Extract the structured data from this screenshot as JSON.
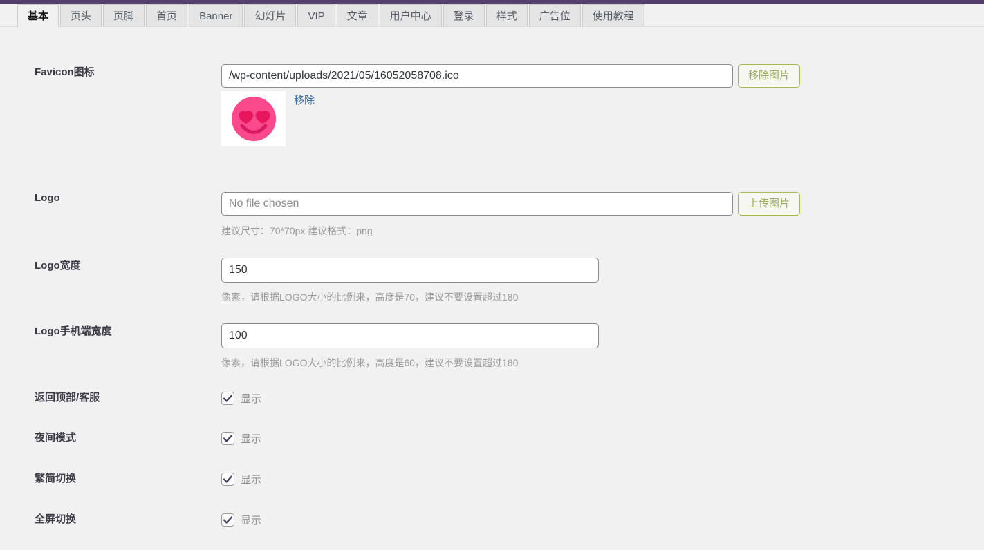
{
  "theme": {
    "adminbar_color": "#523f6d",
    "page_background": "#f1f1f1",
    "tab_inactive_background": "#e5e5e5",
    "button_border_color": "#a4bb47",
    "button_text_color": "#9aab5b",
    "link_color": "#3a6fb0",
    "checkmark_color": "#4b3f63",
    "favicon_face_color": "#fb4a8b",
    "favicon_feature_color": "#d81b60"
  },
  "tabs": [
    {
      "label": "基本",
      "active": true
    },
    {
      "label": "页头",
      "active": false
    },
    {
      "label": "页脚",
      "active": false
    },
    {
      "label": "首页",
      "active": false
    },
    {
      "label": "Banner",
      "active": false
    },
    {
      "label": "幻灯片",
      "active": false
    },
    {
      "label": "VIP",
      "active": false
    },
    {
      "label": "文章",
      "active": false
    },
    {
      "label": "用户中心",
      "active": false
    },
    {
      "label": "登录",
      "active": false
    },
    {
      "label": "样式",
      "active": false
    },
    {
      "label": "广告位",
      "active": false
    },
    {
      "label": "使用教程",
      "active": false
    }
  ],
  "rows": {
    "favicon": {
      "label": "Favicon图标",
      "input_value": "/wp-content/uploads/2021/05/16052058708.ico",
      "input_placeholder": "",
      "button_label": "移除图片",
      "remove_link_label": "移除",
      "preview_alt": "favicon-preview"
    },
    "logo": {
      "label": "Logo",
      "input_value": "",
      "input_placeholder": "No file chosen",
      "button_label": "上传图片",
      "help": "建议尺寸：70*70px 建议格式：png"
    },
    "logo_width": {
      "label": "Logo宽度",
      "input_value": "150",
      "input_placeholder": "",
      "help": "像素，请根据LOGO大小的比例来，高度是70，建议不要设置超过180"
    },
    "logo_mobile_width": {
      "label": "Logo手机端宽度",
      "input_value": "100",
      "input_placeholder": "",
      "help": "像素，请根据LOGO大小的比例来，高度是60，建议不要设置超过180"
    },
    "back_to_top": {
      "label": "返回顶部/客服",
      "checkbox_label": "显示",
      "checked": true
    },
    "night_mode": {
      "label": "夜间模式",
      "checkbox_label": "显示",
      "checked": true
    },
    "traditional_simplified": {
      "label": "繁简切换",
      "checkbox_label": "显示",
      "checked": true
    },
    "fullscreen": {
      "label": "全屏切换",
      "checkbox_label": "显示",
      "checked": true
    }
  }
}
